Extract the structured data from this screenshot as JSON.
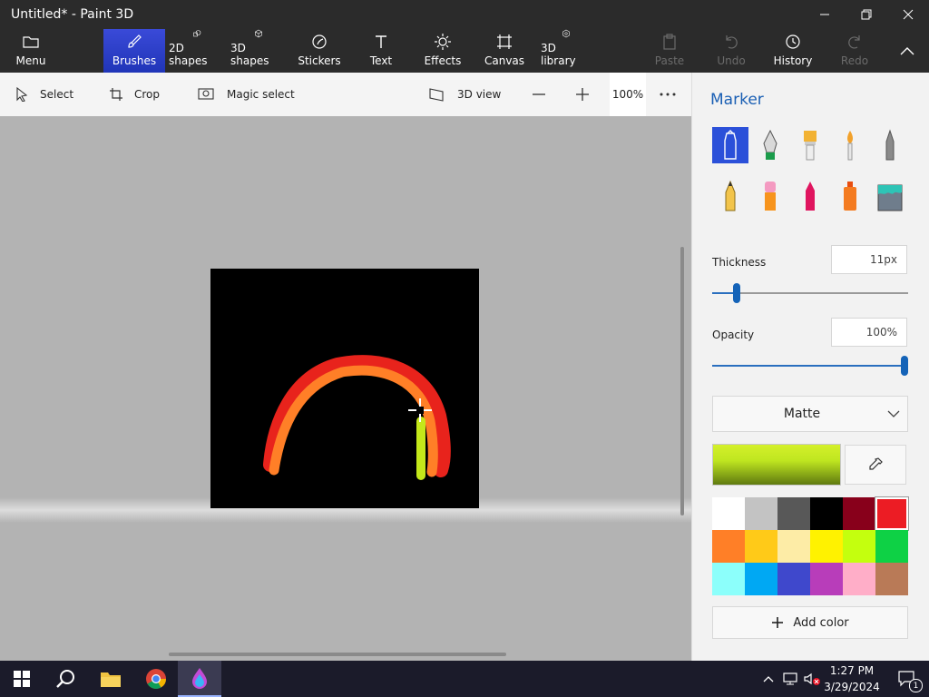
{
  "window": {
    "title": "Untitled* - Paint 3D"
  },
  "ribbon": {
    "menu": "Menu",
    "tabs": [
      {
        "label": "Brushes",
        "icon": "brush-icon",
        "active": true
      },
      {
        "label": "2D shapes",
        "icon": "shapes-2d-icon"
      },
      {
        "label": "3D shapes",
        "icon": "cube-icon"
      },
      {
        "label": "Stickers",
        "icon": "sticker-icon"
      },
      {
        "label": "Text",
        "icon": "text-icon"
      },
      {
        "label": "Effects",
        "icon": "sun-icon"
      },
      {
        "label": "Canvas",
        "icon": "canvas-icon"
      },
      {
        "label": "3D library",
        "icon": "library-icon"
      }
    ],
    "actions": [
      {
        "label": "Paste",
        "enabled": false
      },
      {
        "label": "Undo",
        "enabled": false
      },
      {
        "label": "History",
        "enabled": true
      },
      {
        "label": "Redo",
        "enabled": false
      }
    ]
  },
  "toolbar": {
    "select": "Select",
    "crop": "Crop",
    "magic_select": "Magic select",
    "view_3d": "3D view",
    "zoom": "100%"
  },
  "panel": {
    "title": "Marker",
    "thickness_label": "Thickness",
    "thickness_value": "11px",
    "thickness_level": 0.11,
    "opacity_label": "Opacity",
    "opacity_value": "100%",
    "opacity_level": 1.0,
    "finish": "Matte",
    "selected_color": "#d4f02a",
    "palette": [
      "#ffffff",
      "#c3c3c3",
      "#585858",
      "#000000",
      "#88001b",
      "#ec1c24",
      "#ff7f27",
      "#ffca18",
      "#fdeca6",
      "#fff200",
      "#c4ff0e",
      "#0ed145",
      "#8cfffb",
      "#00a8f3",
      "#3f48cc",
      "#b83dba",
      "#ffaec8",
      "#b97a57"
    ],
    "add_color": "Add color"
  },
  "taskbar": {
    "time": "1:27 PM",
    "date": "3/29/2024",
    "notifications": "1"
  }
}
